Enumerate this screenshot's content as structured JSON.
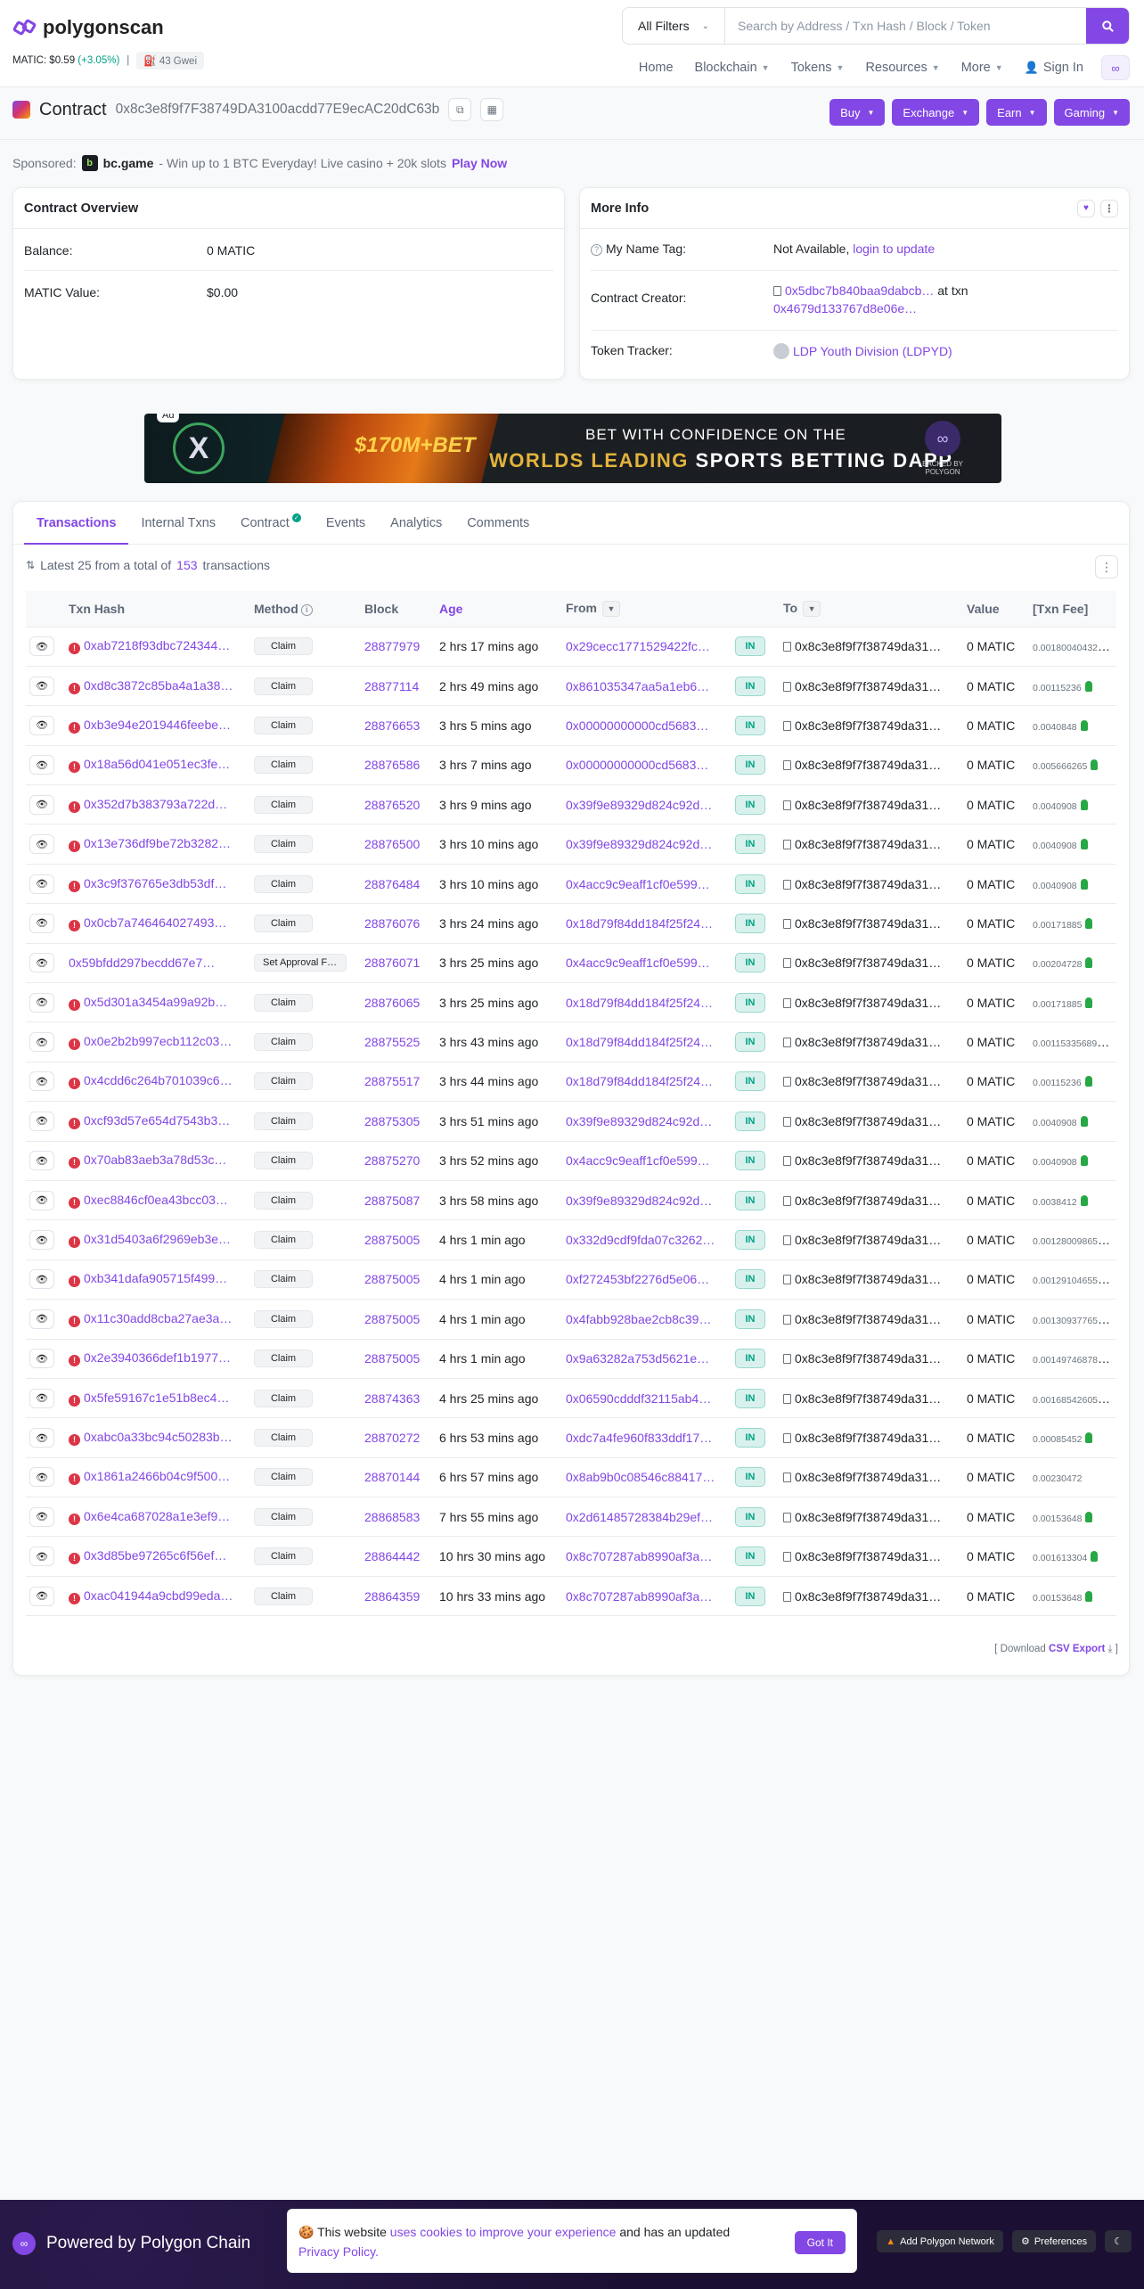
{
  "header": {
    "logo_text": "polygonscan",
    "price_label": "MATIC: $0.59",
    "price_change": "(+3.05%)",
    "gas": "43 Gwei",
    "filter_label": "All Filters",
    "search_placeholder": "Search by Address / Txn Hash / Block / Token",
    "nav": {
      "home": "Home",
      "blockchain": "Blockchain",
      "tokens": "Tokens",
      "resources": "Resources",
      "more": "More",
      "sign_in": "Sign In"
    }
  },
  "page": {
    "type_label": "Contract",
    "address": "0x8c3e8f9f7F38749DA3100acdd77E9ecAC20dC63b",
    "action_buttons": [
      "Buy",
      "Exchange",
      "Earn",
      "Gaming"
    ]
  },
  "sponsored": {
    "label": "Sponsored:",
    "brand": "bc.game",
    "text": "- Win up to 1 BTC Everyday! Live casino + 20k slots",
    "cta": "Play Now"
  },
  "overview": {
    "title": "Contract Overview",
    "balance_label": "Balance:",
    "balance_value": "0 MATIC",
    "value_label": "MATIC Value:",
    "value_value": "$0.00"
  },
  "more_info": {
    "title": "More Info",
    "name_tag_label": "My Name Tag:",
    "name_tag_value": "Not Available,",
    "name_tag_link": "login to update",
    "creator_label": "Contract Creator:",
    "creator_addr": "0x5dbc7b840baa9dabcb…",
    "creator_at": "at txn",
    "creator_txn": "0x4679d133767d8e06e…",
    "tracker_label": "Token Tracker:",
    "tracker_value": "LDP Youth Division (LDPYD)"
  },
  "ad": {
    "tag": "Ad",
    "amount": "$170M+BET",
    "line1": "BET WITH CONFIDENCE ON THE",
    "line2_a": "WORLDS LEADING",
    "line2_b": "SPORTS BETTING DAPP",
    "backed": "BACKED BY POLYGON"
  },
  "tabs": [
    "Transactions",
    "Internal Txns",
    "Contract",
    "Events",
    "Analytics",
    "Comments"
  ],
  "summary": {
    "prefix": "Latest 25 from a total of",
    "count": "153",
    "suffix": "transactions"
  },
  "columns": [
    "Txn Hash",
    "Method",
    "Block",
    "Age",
    "From",
    "To",
    "Value",
    "[Txn Fee]"
  ],
  "transactions": [
    {
      "hash": "0xab7218f93dbc724344…",
      "err": true,
      "method": "Claim",
      "block": "28877979",
      "age": "2 hrs 17 mins ago",
      "from": "0x29cecc1771529422fc…",
      "dir": "IN",
      "to": "0x8c3e8f9f7f38749da31…",
      "value": "0 MATIC",
      "fee": "0.001800404321"
    },
    {
      "hash": "0xd8c3872c85ba4a1a38…",
      "err": true,
      "method": "Claim",
      "block": "28877114",
      "age": "2 hrs 49 mins ago",
      "from": "0x861035347aa5a1eb6…",
      "dir": "IN",
      "to": "0x8c3e8f9f7f38749da31…",
      "value": "0 MATIC",
      "fee": "0.00115236"
    },
    {
      "hash": "0xb3e94e2019446feebe…",
      "err": true,
      "method": "Claim",
      "block": "28876653",
      "age": "3 hrs 5 mins ago",
      "from": "0x00000000000cd5683…",
      "dir": "IN",
      "to": "0x8c3e8f9f7f38749da31…",
      "value": "0 MATIC",
      "fee": "0.0040848"
    },
    {
      "hash": "0x18a56d041e051ec3fe…",
      "err": true,
      "method": "Claim",
      "block": "28876586",
      "age": "3 hrs 7 mins ago",
      "from": "0x00000000000cd5683…",
      "dir": "IN",
      "to": "0x8c3e8f9f7f38749da31…",
      "value": "0 MATIC",
      "fee": "0.005666265"
    },
    {
      "hash": "0x352d7b383793a722d…",
      "err": true,
      "method": "Claim",
      "block": "28876520",
      "age": "3 hrs 9 mins ago",
      "from": "0x39f9e89329d824c92d…",
      "dir": "IN",
      "to": "0x8c3e8f9f7f38749da31…",
      "value": "0 MATIC",
      "fee": "0.0040908"
    },
    {
      "hash": "0x13e736df9be72b3282…",
      "err": true,
      "method": "Claim",
      "block": "28876500",
      "age": "3 hrs 10 mins ago",
      "from": "0x39f9e89329d824c92d…",
      "dir": "IN",
      "to": "0x8c3e8f9f7f38749da31…",
      "value": "0 MATIC",
      "fee": "0.0040908"
    },
    {
      "hash": "0x3c9f376765e3db53df…",
      "err": true,
      "method": "Claim",
      "block": "28876484",
      "age": "3 hrs 10 mins ago",
      "from": "0x4acc9c9eaff1cf0e599…",
      "dir": "IN",
      "to": "0x8c3e8f9f7f38749da31…",
      "value": "0 MATIC",
      "fee": "0.0040908"
    },
    {
      "hash": "0x0cb7a746464027493…",
      "err": true,
      "method": "Claim",
      "block": "28876076",
      "age": "3 hrs 24 mins ago",
      "from": "0x18d79f84dd184f25f24…",
      "dir": "IN",
      "to": "0x8c3e8f9f7f38749da31…",
      "value": "0 MATIC",
      "fee": "0.00171885"
    },
    {
      "hash": "0x59bfdd297becdd67e7…",
      "err": false,
      "method": "Set Approval For…",
      "block": "28876071",
      "age": "3 hrs 25 mins ago",
      "from": "0x4acc9c9eaff1cf0e599…",
      "dir": "IN",
      "to": "0x8c3e8f9f7f38749da31…",
      "value": "0 MATIC",
      "fee": "0.00204728"
    },
    {
      "hash": "0x5d301a3454a99a92b…",
      "err": true,
      "method": "Claim",
      "block": "28876065",
      "age": "3 hrs 25 mins ago",
      "from": "0x18d79f84dd184f25f24…",
      "dir": "IN",
      "to": "0x8c3e8f9f7f38749da31…",
      "value": "0 MATIC",
      "fee": "0.00171885"
    },
    {
      "hash": "0x0e2b2b997ecb112c03…",
      "err": true,
      "method": "Claim",
      "block": "28875525",
      "age": "3 hrs 43 mins ago",
      "from": "0x18d79f84dd184f25f24…",
      "dir": "IN",
      "to": "0x8c3e8f9f7f38749da31…",
      "value": "0 MATIC",
      "fee": "0.001153356895"
    },
    {
      "hash": "0x4cdd6c264b701039c6…",
      "err": true,
      "method": "Claim",
      "block": "28875517",
      "age": "3 hrs 44 mins ago",
      "from": "0x18d79f84dd184f25f24…",
      "dir": "IN",
      "to": "0x8c3e8f9f7f38749da31…",
      "value": "0 MATIC",
      "fee": "0.00115236"
    },
    {
      "hash": "0xcf93d57e654d7543b3…",
      "err": true,
      "method": "Claim",
      "block": "28875305",
      "age": "3 hrs 51 mins ago",
      "from": "0x39f9e89329d824c92d…",
      "dir": "IN",
      "to": "0x8c3e8f9f7f38749da31…",
      "value": "0 MATIC",
      "fee": "0.0040908"
    },
    {
      "hash": "0x70ab83aeb3a78d53c…",
      "err": true,
      "method": "Claim",
      "block": "28875270",
      "age": "3 hrs 52 mins ago",
      "from": "0x4acc9c9eaff1cf0e599…",
      "dir": "IN",
      "to": "0x8c3e8f9f7f38749da31…",
      "value": "0 MATIC",
      "fee": "0.0040908"
    },
    {
      "hash": "0xec8846cf0ea43bcc03…",
      "err": true,
      "method": "Claim",
      "block": "28875087",
      "age": "3 hrs 58 mins ago",
      "from": "0x39f9e89329d824c92d…",
      "dir": "IN",
      "to": "0x8c3e8f9f7f38749da31…",
      "value": "0 MATIC",
      "fee": "0.0038412"
    },
    {
      "hash": "0x31d5403a6f2969eb3e…",
      "err": true,
      "method": "Claim",
      "block": "28875005",
      "age": "4 hrs 1 min ago",
      "from": "0x332d9cdf9fda07c3262…",
      "dir": "IN",
      "to": "0x8c3e8f9f7f38749da31…",
      "value": "0 MATIC",
      "fee": "0.001280098654"
    },
    {
      "hash": "0xb341dafa905715f499…",
      "err": true,
      "method": "Claim",
      "block": "28875005",
      "age": "4 hrs 1 min ago",
      "from": "0xf272453bf2276d5e06…",
      "dir": "IN",
      "to": "0x8c3e8f9f7f38749da31…",
      "value": "0 MATIC",
      "fee": "0.001291046555"
    },
    {
      "hash": "0x11c30add8cba27ae3a…",
      "err": true,
      "method": "Claim",
      "block": "28875005",
      "age": "4 hrs 1 min ago",
      "from": "0x4fabb928bae2cb8c39…",
      "dir": "IN",
      "to": "0x8c3e8f9f7f38749da31…",
      "value": "0 MATIC",
      "fee": "0.001309377654"
    },
    {
      "hash": "0x2e3940366def1b1977…",
      "err": true,
      "method": "Claim",
      "block": "28875005",
      "age": "4 hrs 1 min ago",
      "from": "0x9a63282a753d5621e…",
      "dir": "IN",
      "to": "0x8c3e8f9f7f38749da31…",
      "value": "0 MATIC",
      "fee": "0.001497468784"
    },
    {
      "hash": "0x5fe59167c1e51b8ec4…",
      "err": true,
      "method": "Claim",
      "block": "28874363",
      "age": "4 hrs 25 mins ago",
      "from": "0x06590cdddf32115ab4…",
      "dir": "IN",
      "to": "0x8c3e8f9f7f38749da31…",
      "value": "0 MATIC",
      "fee": "0.001685426057"
    },
    {
      "hash": "0xabc0a33bc94c50283b…",
      "err": true,
      "method": "Claim",
      "block": "28870272",
      "age": "6 hrs 53 mins ago",
      "from": "0xdc7a4fe960f833ddf17…",
      "dir": "IN",
      "to": "0x8c3e8f9f7f38749da31…",
      "value": "0 MATIC",
      "fee": "0.00085452"
    },
    {
      "hash": "0x1861a2466b04c9f500…",
      "err": true,
      "method": "Claim",
      "block": "28870144",
      "age": "6 hrs 57 mins ago",
      "from": "0x8ab9b0c08546c88417…",
      "dir": "IN",
      "to": "0x8c3e8f9f7f38749da31…",
      "value": "0 MATIC",
      "fee": "0.00230472"
    },
    {
      "hash": "0x6e4ca687028a1e3ef9…",
      "err": true,
      "method": "Claim",
      "block": "28868583",
      "age": "7 hrs 55 mins ago",
      "from": "0x2d61485728384b29ef…",
      "dir": "IN",
      "to": "0x8c3e8f9f7f38749da31…",
      "value": "0 MATIC",
      "fee": "0.00153648"
    },
    {
      "hash": "0x3d85be97265c6f56ef…",
      "err": true,
      "method": "Claim",
      "block": "28864442",
      "age": "10 hrs 30 mins ago",
      "from": "0x8c707287ab8990af3a…",
      "dir": "IN",
      "to": "0x8c3e8f9f7f38749da31…",
      "value": "0 MATIC",
      "fee": "0.001613304"
    },
    {
      "hash": "0xac041944a9cbd99eda…",
      "err": true,
      "method": "Claim",
      "block": "28864359",
      "age": "10 hrs 33 mins ago",
      "from": "0x8c707287ab8990af3a…",
      "dir": "IN",
      "to": "0x8c3e8f9f7f38749da31…",
      "value": "0 MATIC",
      "fee": "0.00153648"
    }
  ],
  "csv": {
    "prefix": "[ Download",
    "link": "CSV Export",
    "suffix": "]"
  },
  "footer": {
    "powered": "Powered by Polygon Chain",
    "cookie_a": "This website",
    "cookie_link1": "uses cookies to improve your experience",
    "cookie_b": "and has an updated",
    "cookie_link2": "Privacy Policy.",
    "got_it": "Got It",
    "add_network": "Add Polygon Network",
    "preferences": "Preferences"
  },
  "colors": {
    "accent": "#8247e5",
    "success": "#00a186",
    "error": "#dc3545"
  }
}
